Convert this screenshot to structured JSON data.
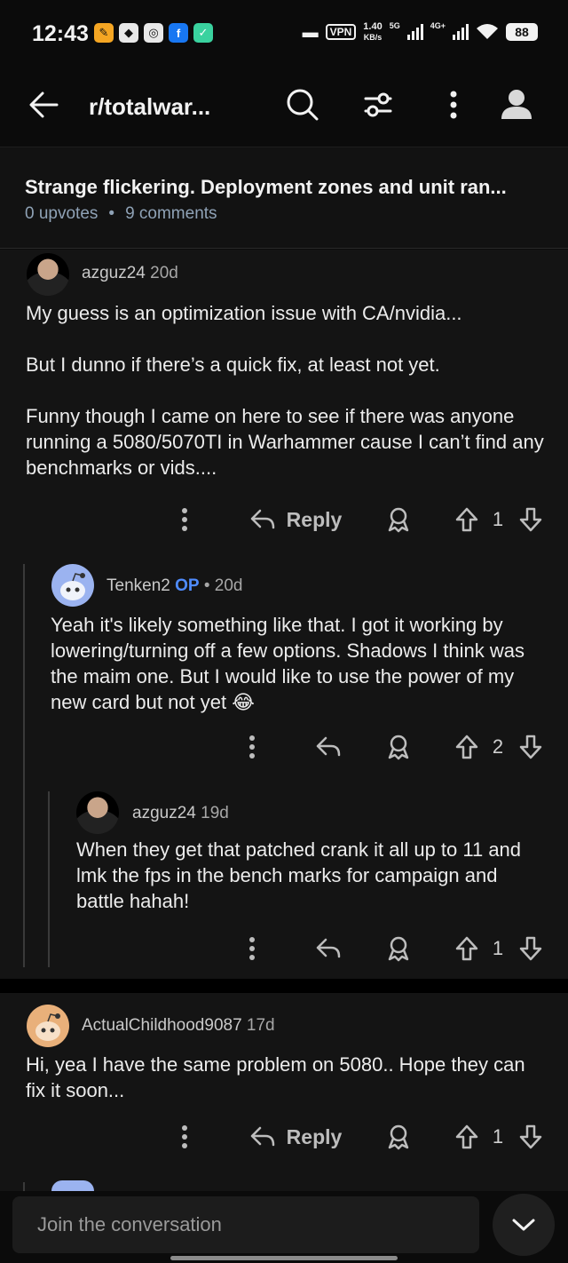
{
  "status": {
    "time": "12:43",
    "vpn": "VPN",
    "speed_value": "1.40",
    "speed_unit": "KB/s",
    "net1": "5G",
    "net2": "4G+",
    "battery": "88"
  },
  "appbar": {
    "title": "r/totalwar..."
  },
  "post": {
    "title": "Strange flickering. Deployment zones and unit ran...",
    "upvotes": "0 upvotes",
    "separator": "•",
    "comments": "9 comments"
  },
  "comments": [
    {
      "user": "azguz24",
      "age": "20d",
      "paragraphs": [
        "My guess is an optimization issue with CA/nvidia...",
        "But I dunno if there’s a quick fix, at least not yet.",
        "Funny though I came on here to see if there was anyone running a 5080/5070TI in Warhammer cause I can’t find any benchmarks or vids...."
      ],
      "reply_label": "Reply",
      "votes": "1"
    },
    {
      "user": "Tenken2",
      "op_badge": "OP",
      "age_prefix": "• 20d",
      "text": "Yeah it's likely something like that. I got it working by lowering/turning off a few options. Shadows I think was the maim one. But I would like to use the power of my new card but not yet 😂",
      "votes": "2"
    },
    {
      "user": "azguz24",
      "age": "19d",
      "text": "When they get that patched crank it all up to 11 and lmk the fps in the bench marks for campaign and battle hahah!",
      "votes": "1"
    },
    {
      "user": "ActualChildhood9087",
      "age": "17d",
      "text": "Hi, yea I have the same problem on 5080.. Hope they can fix it soon...",
      "reply_label": "Reply",
      "votes": "1"
    }
  ],
  "composer": {
    "placeholder": "Join the conversation"
  }
}
